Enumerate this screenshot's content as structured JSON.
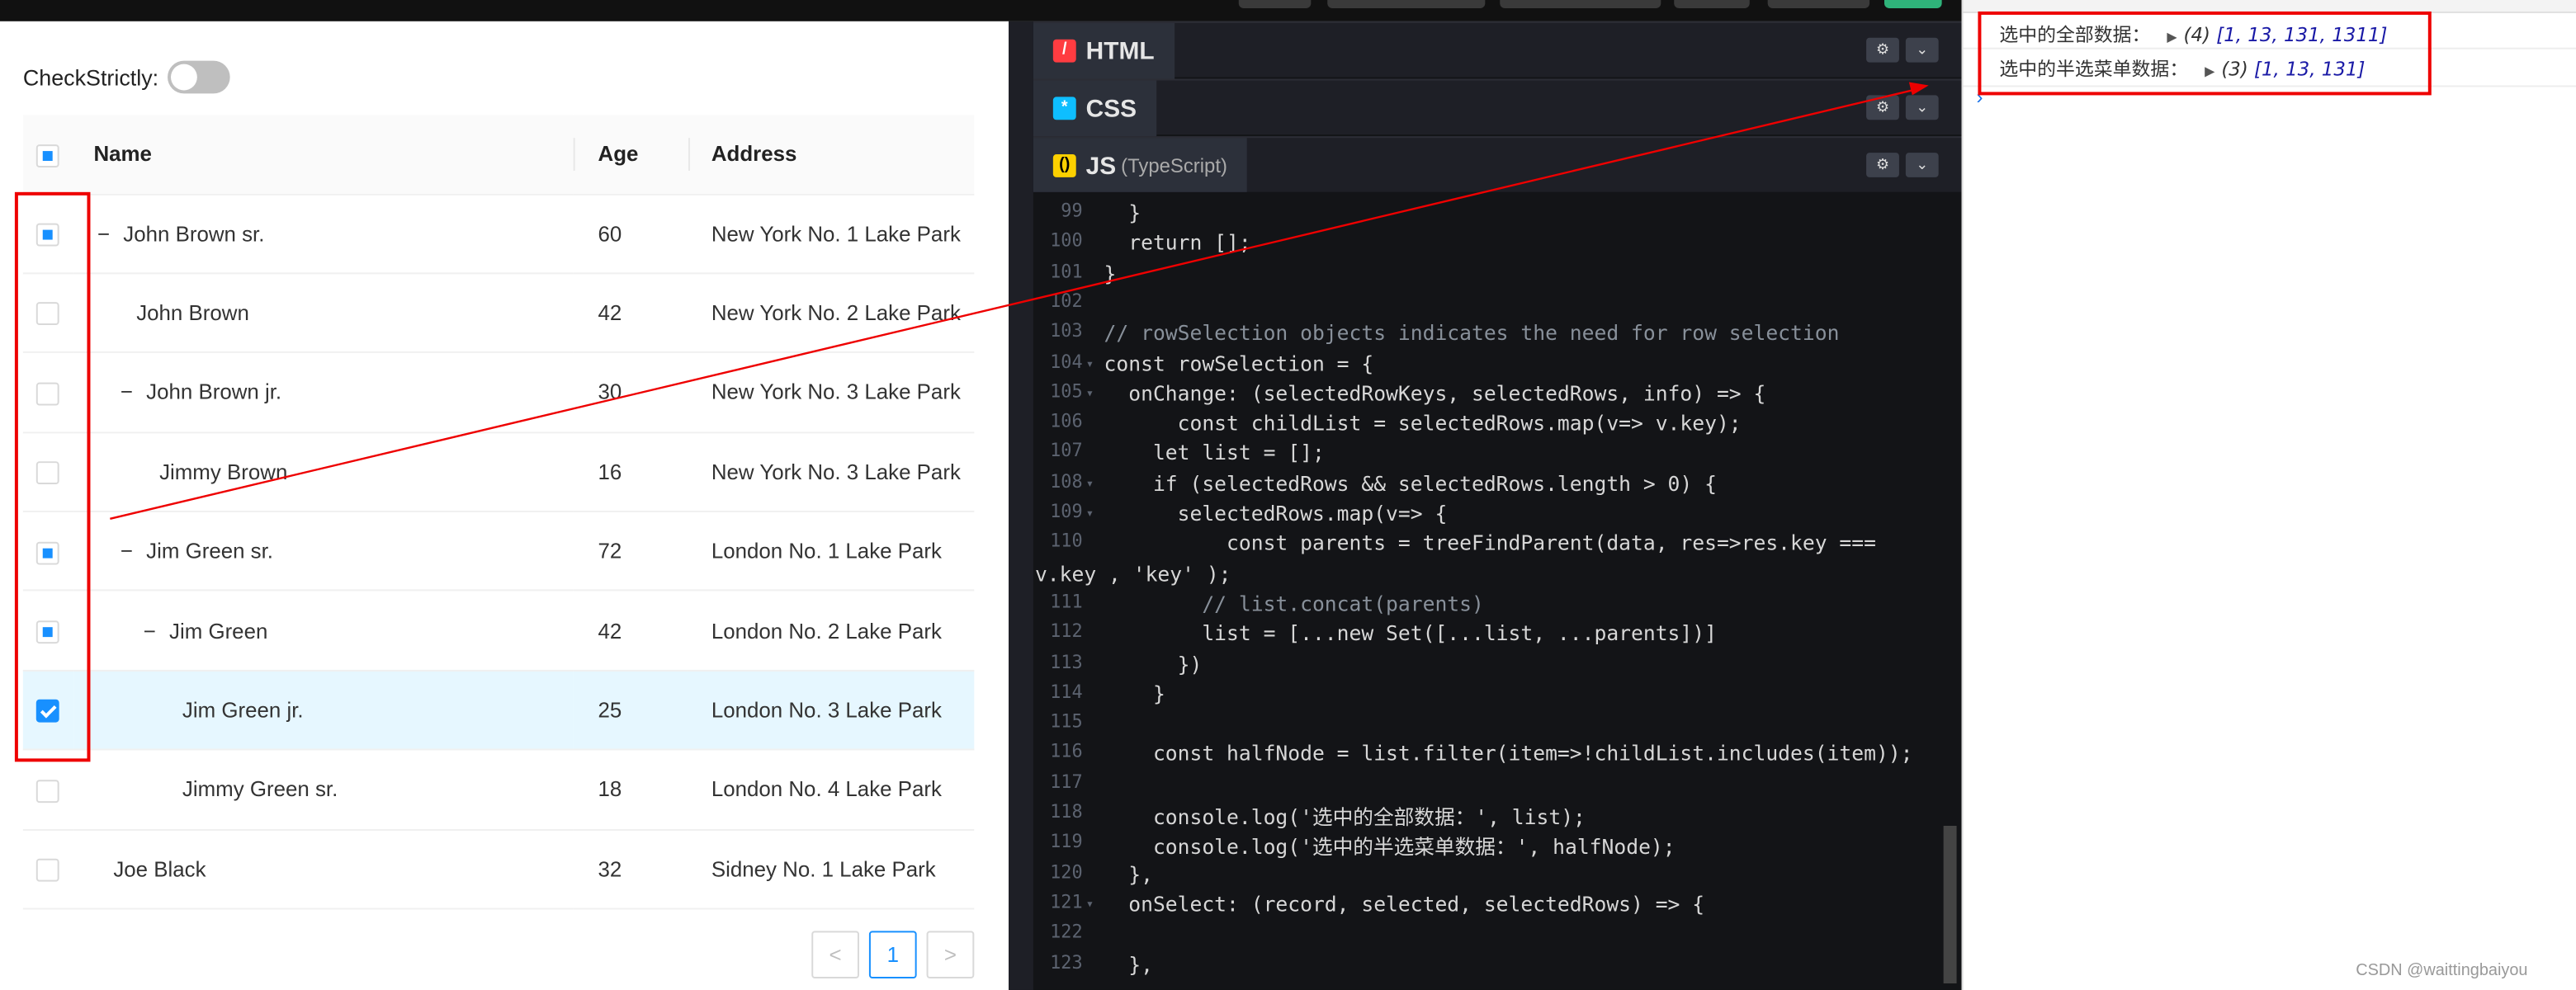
{
  "left_panel": {
    "check_strictly_label": "CheckStrictly:",
    "columns": {
      "name": "Name",
      "age": "Age",
      "address": "Address"
    },
    "rows": [
      {
        "name": "John Brown sr.",
        "age": "60",
        "address": "New York No. 1 Lake Park",
        "state": "half",
        "expand": "−",
        "level": 0
      },
      {
        "name": "John Brown",
        "age": "42",
        "address": "New York No. 2 Lake Park",
        "state": "none",
        "expand": "",
        "level": 1
      },
      {
        "name": "John Brown jr.",
        "age": "30",
        "address": "New York No. 3 Lake Park",
        "state": "none",
        "expand": "−",
        "level": 1
      },
      {
        "name": "Jimmy Brown",
        "age": "16",
        "address": "New York No. 3 Lake Park",
        "state": "none",
        "expand": "",
        "level": 2
      },
      {
        "name": "Jim Green sr.",
        "age": "72",
        "address": "London No. 1 Lake Park",
        "state": "half",
        "expand": "−",
        "level": 1
      },
      {
        "name": "Jim Green",
        "age": "42",
        "address": "London No. 2 Lake Park",
        "state": "half",
        "expand": "−",
        "level": 2
      },
      {
        "name": "Jim Green jr.",
        "age": "25",
        "address": "London No. 3 Lake Park",
        "state": "checked",
        "expand": "",
        "level": 3
      },
      {
        "name": "Jimmy Green sr.",
        "age": "18",
        "address": "London No. 4 Lake Park",
        "state": "none",
        "expand": "",
        "level": 3
      },
      {
        "name": "Joe Black",
        "age": "32",
        "address": "Sidney No. 1 Lake Park",
        "state": "none",
        "expand": "",
        "level": 0
      }
    ],
    "pagination": {
      "prev": "<",
      "current": "1",
      "next": ">"
    }
  },
  "editor": {
    "html_tab": "HTML",
    "css_tab": "CSS",
    "js_tab": "JS",
    "js_tab_suffix": "(TypeScript)",
    "line_numbers": [
      "99",
      "100",
      "101",
      "102",
      "103",
      "104",
      "105",
      "106",
      "107",
      "108",
      "109",
      "110",
      "",
      "111",
      "112",
      "113",
      "114",
      "115",
      "116",
      "117",
      "118",
      "119",
      "120",
      "121",
      "122",
      "123"
    ],
    "code_lines": [
      "  }",
      "  return [];",
      "}",
      "",
      "// rowSelection objects indicates the need for row selection",
      "const rowSelection = {",
      "  onChange: (selectedRowKeys, selectedRows, info) => {",
      "      const childList = selectedRows.map(v=> v.key);",
      "    let list = [];",
      "    if (selectedRows && selectedRows.length > 0) {",
      "      selectedRows.map(v=> {",
      "          const parents = treeFindParent(data, res=>res.key ===",
      "v.key , 'key' );",
      "        // list.concat(parents)",
      "        list = [...new Set([...list, ...parents])]",
      "      })",
      "    }",
      "",
      "    const halfNode = list.filter(item=>!childList.includes(item));",
      "",
      "    console.log('选中的全部数据：', list);",
      "    console.log('选中的半选菜单数据：', halfNode);",
      "  },",
      "  onSelect: (record, selected, selectedRows) => {",
      "",
      "  },"
    ]
  },
  "console": {
    "line1_label": "选中的全部数据：",
    "line1_count": "(4)",
    "line1_value": "[1, 13, 131, 1311]",
    "line2_label": "选中的半选菜单数据：",
    "line2_count": "(3)",
    "line2_value": "[1, 13, 131]",
    "prompt": "›"
  },
  "watermark": "CSDN @waittingbaiyou",
  "colors": {
    "accent": "#1890ff",
    "annotation": "#e00000",
    "editor_bg": "#131417"
  }
}
